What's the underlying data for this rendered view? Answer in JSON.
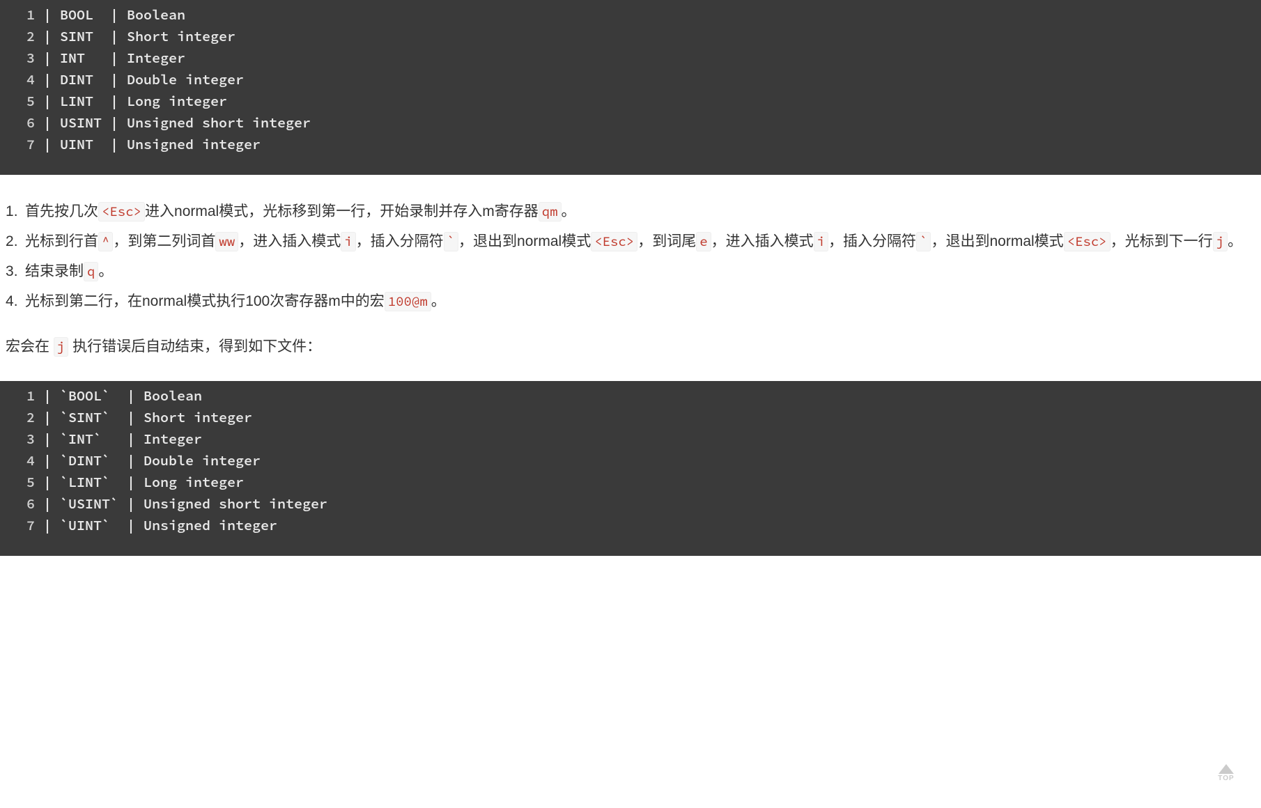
{
  "code1": [
    "| BOOL  | Boolean",
    "| SINT  | Short integer",
    "| INT   | Integer",
    "| DINT  | Double integer",
    "| LINT  | Long integer",
    "| USINT | Unsigned short integer",
    "| UINT  | Unsigned integer"
  ],
  "steps": [
    {
      "parts": [
        {
          "t": "首先按几次"
        },
        {
          "k": "<Esc>"
        },
        {
          "t": "进入normal模式，光标移到第一行，开始录制并存入m寄存器"
        },
        {
          "k": "qm"
        },
        {
          "t": "。"
        }
      ]
    },
    {
      "parts": [
        {
          "t": "光标到行首"
        },
        {
          "k": "^"
        },
        {
          "t": "，到第二列词首"
        },
        {
          "k": "ww"
        },
        {
          "t": "，进入插入模式"
        },
        {
          "k": "i"
        },
        {
          "t": "，插入分隔符"
        },
        {
          "k": "`"
        },
        {
          "t": "，退出到normal模式"
        },
        {
          "k": "<Esc>"
        },
        {
          "t": "，到词尾"
        },
        {
          "k": "e"
        },
        {
          "t": "，进入插入模式"
        },
        {
          "k": "i"
        },
        {
          "t": "，插入分隔符"
        },
        {
          "k": "`"
        },
        {
          "t": "，退出到normal模式"
        },
        {
          "k": "<Esc>"
        },
        {
          "t": "，光标到下一行"
        },
        {
          "k": "j"
        },
        {
          "t": "。"
        }
      ]
    },
    {
      "parts": [
        {
          "t": "结束录制"
        },
        {
          "k": "q"
        },
        {
          "t": "。"
        }
      ]
    },
    {
      "parts": [
        {
          "t": "光标到第二行，在normal模式执行100次寄存器m中的宏"
        },
        {
          "k": "100@m"
        },
        {
          "t": "。"
        }
      ]
    }
  ],
  "after": {
    "parts": [
      {
        "t": "宏会在 "
      },
      {
        "k": "j"
      },
      {
        "t": " 执行错误后自动结束，得到如下文件："
      }
    ]
  },
  "code2": [
    "| `BOOL`  | Boolean",
    "| `SINT`  | Short integer",
    "| `INT`   | Integer",
    "| `DINT`  | Double integer",
    "| `LINT`  | Long integer",
    "| `USINT` | Unsigned short integer",
    "| `UINT`  | Unsigned integer"
  ],
  "top_label": "TOP"
}
